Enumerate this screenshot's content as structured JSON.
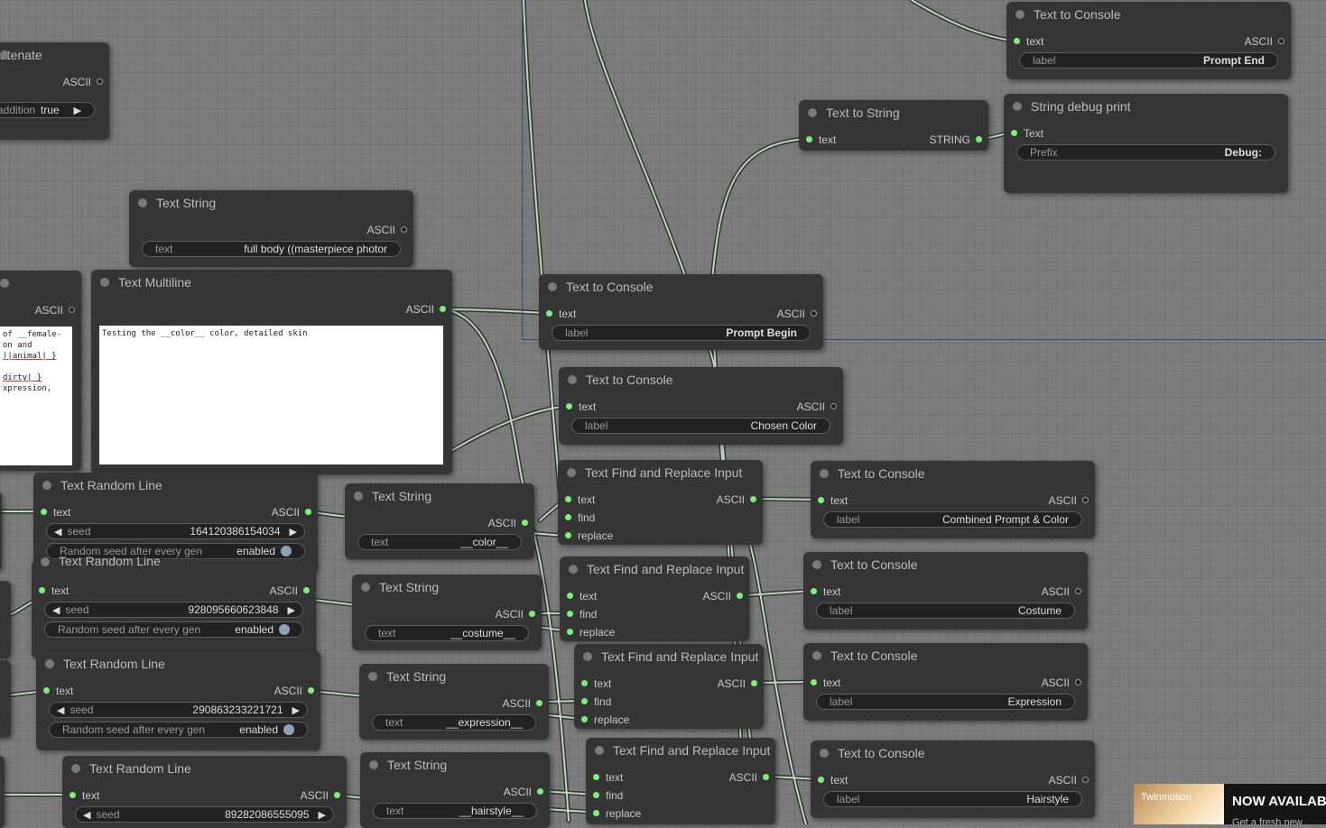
{
  "concat_node": {
    "title": "atenate",
    "output_label": "ASCII",
    "widget_label": "addition",
    "widget_value": "true"
  },
  "text_string_top": {
    "title": "Text String",
    "output_label": "ASCII",
    "widget_label": "text",
    "widget_value": "full body ((masterpiece photor"
  },
  "left_partial_node": {
    "output_label": "ASCII",
    "text_lines": [
      "of __female-",
      "on and",
      "||animal| }",
      "",
      "dirty| }",
      "xpression,"
    ]
  },
  "text_multiline": {
    "title": "Text Multiline",
    "output_label": "ASCII",
    "text": "Testing the __color__ color, detailed skin"
  },
  "console_prompt_end": {
    "title": "Text to Console",
    "input_label": "text",
    "output_label": "ASCII",
    "widget_label": "label",
    "widget_value": "Prompt End"
  },
  "text_to_string": {
    "title": "Text to String",
    "input_label": "text",
    "output_label": "STRING"
  },
  "string_debug_print": {
    "title": "String debug print",
    "input_label": "Text",
    "widget_label": "Prefix",
    "widget_value": "Debug:"
  },
  "console_prompt_begin": {
    "title": "Text to Console",
    "input_label": "text",
    "output_label": "ASCII",
    "widget_label": "label",
    "widget_value": "Prompt Begin"
  },
  "console_chosen_color": {
    "title": "Text to Console",
    "input_label": "text",
    "output_label": "ASCII",
    "widget_label": "label",
    "widget_value": "Chosen Color"
  },
  "find_replace_nodes": [
    {
      "title": "Text Find and Replace Input",
      "inputs": [
        "text",
        "find",
        "replace"
      ],
      "output_label": "ASCII"
    },
    {
      "title": "Text Find and Replace Input",
      "inputs": [
        "text",
        "find",
        "replace"
      ],
      "output_label": "ASCII"
    },
    {
      "title": "Text Find and Replace Input",
      "inputs": [
        "text",
        "find",
        "replace"
      ],
      "output_label": "ASCII"
    },
    {
      "title": "Text Find and Replace Input",
      "inputs": [
        "text",
        "find",
        "replace"
      ],
      "output_label": "ASCII"
    }
  ],
  "console_nodes_right": [
    {
      "title": "Text to Console",
      "input_label": "text",
      "output_label": "ASCII",
      "widget_label": "label",
      "widget_value": "Combined Prompt & Color"
    },
    {
      "title": "Text to Console",
      "input_label": "text",
      "output_label": "ASCII",
      "widget_label": "label",
      "widget_value": "Costume"
    },
    {
      "title": "Text to Console",
      "input_label": "text",
      "output_label": "ASCII",
      "widget_label": "label",
      "widget_value": "Expression"
    },
    {
      "title": "Text to Console",
      "input_label": "text",
      "output_label": "ASCII",
      "widget_label": "label",
      "widget_value": "Hairstyle"
    }
  ],
  "text_strings": [
    {
      "title": "Text String",
      "output_label": "ASCII",
      "widget_label": "text",
      "widget_value": "__color__"
    },
    {
      "title": "Text String",
      "output_label": "ASCII",
      "widget_label": "text",
      "widget_value": "__costume__"
    },
    {
      "title": "Text String",
      "output_label": "ASCII",
      "widget_label": "text",
      "widget_value": "__expression__"
    },
    {
      "title": "Text String",
      "output_label": "ASCII",
      "widget_label": "text",
      "widget_value": "__hairstyle__"
    }
  ],
  "random_lines": [
    {
      "title": "Text Random Line",
      "input_label": "text",
      "output_label": "ASCII",
      "seed_label": "seed",
      "seed_value": "164120386154034",
      "toggle_label": "Random seed after every gen",
      "toggle_value": "enabled"
    },
    {
      "title": "Text Random Line",
      "input_label": "text",
      "output_label": "ASCII",
      "seed_label": "seed",
      "seed_value": "928095660623848",
      "toggle_label": "Random seed after every gen",
      "toggle_value": "enabled"
    },
    {
      "title": "Text Random Line",
      "input_label": "text",
      "output_label": "ASCII",
      "seed_label": "seed",
      "seed_value": "290863233221721",
      "toggle_label": "Random seed after every gen",
      "toggle_value": "enabled"
    },
    {
      "title": "Text Random Line",
      "input_label": "text",
      "output_label": "ASCII",
      "seed_label": "seed",
      "seed_value": "89282086555095"
    }
  ],
  "ad": {
    "brand": "Twinmotion",
    "headline": "NOW AVAILAB",
    "subline": "Get a fresh new"
  },
  "colors": {
    "canvas": "#7c7c7c",
    "node_bg": "#353535",
    "slot_connected": "#7cf07c",
    "wire": "#c8d0c8",
    "group_border": "#3a4f7a"
  }
}
